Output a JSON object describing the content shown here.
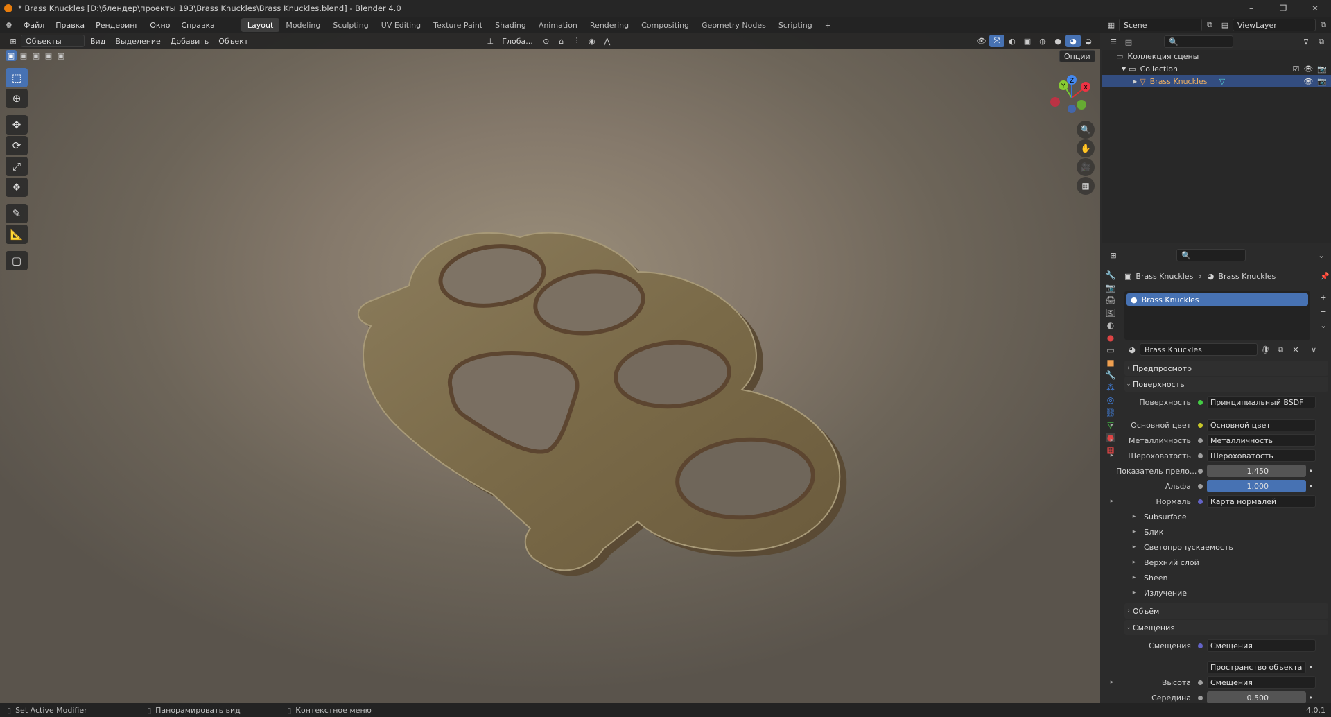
{
  "window": {
    "title": "* Brass Knuckles [D:\\блендер\\проекты 193\\Brass Knuckles\\Brass Knuckles.blend] - Blender 4.0",
    "minimize": "–",
    "maximize": "❐",
    "close": "✕"
  },
  "menu": [
    "Файл",
    "Правка",
    "Рендеринг",
    "Окно",
    "Справка"
  ],
  "workspaces": [
    "Layout",
    "Modeling",
    "Sculpting",
    "UV Editing",
    "Texture Paint",
    "Shading",
    "Animation",
    "Rendering",
    "Compositing",
    "Geometry Nodes",
    "Scripting",
    "+"
  ],
  "active_workspace": "Layout",
  "scene": {
    "label": "Scene",
    "viewlayer": "ViewLayer"
  },
  "viewport_header": {
    "mode": "Объекты",
    "menus": [
      "Вид",
      "Выделение",
      "Добавить",
      "Объект"
    ],
    "orientation": "Глоба...",
    "options": "Опции"
  },
  "gizmo": {
    "x": "X",
    "y": "Y",
    "z": "Z"
  },
  "outliner": {
    "root": "Коллекция сцены",
    "collection": "Collection",
    "object": "Brass Knuckles"
  },
  "properties": {
    "breadcrumb_object": "Brass Knuckles",
    "breadcrumb_material": "Brass Knuckles",
    "slot": "Brass Knuckles",
    "material_name": "Brass Knuckles",
    "sections": {
      "preview": "Предпросмотр",
      "surface": "Поверхность",
      "volume": "Объём",
      "displacement": "Смещения"
    },
    "surface_label": "Поверхность",
    "surface_value": "Принципиальный BSDF",
    "rows": [
      {
        "label": "Основной цвет",
        "value": "Основной цвет",
        "color": "#c7c729",
        "tri": true
      },
      {
        "label": "Металличность",
        "value": "Металличность",
        "color": "#a0a0a0",
        "tri": true
      },
      {
        "label": "Шероховатость",
        "value": "Шероховатость",
        "color": "#a0a0a0",
        "tri": true
      },
      {
        "label": "Показатель прело...",
        "value": "1.450",
        "color": "#a0a0a0",
        "num": true
      },
      {
        "label": "Альфа",
        "value": "1.000",
        "color": "#a0a0a0",
        "hl": true
      },
      {
        "label": "Нормаль",
        "value": "Карта нормалей",
        "color": "#6363c7",
        "tri": true
      }
    ],
    "subpanels": [
      "Subsurface",
      "Блик",
      "Светопропускаемость",
      "Верхний слой",
      "Sheen",
      "Излучение"
    ],
    "disp_rows": [
      {
        "label": "Смещения",
        "value": "Смещения",
        "color": "#6363c7"
      },
      {
        "label": "",
        "value": "Пространство объекта",
        "color": ""
      },
      {
        "label": "Высота",
        "value": "Смещения",
        "color": "#a0a0a0",
        "tri": true
      },
      {
        "label": "Середина",
        "value": "0.500",
        "color": "#a0a0a0",
        "num": true
      }
    ]
  },
  "status": {
    "left": "Set Active Modifier",
    "mid": "Панорамировать вид",
    "right": "Контекстное меню",
    "version": "4.0.1"
  }
}
